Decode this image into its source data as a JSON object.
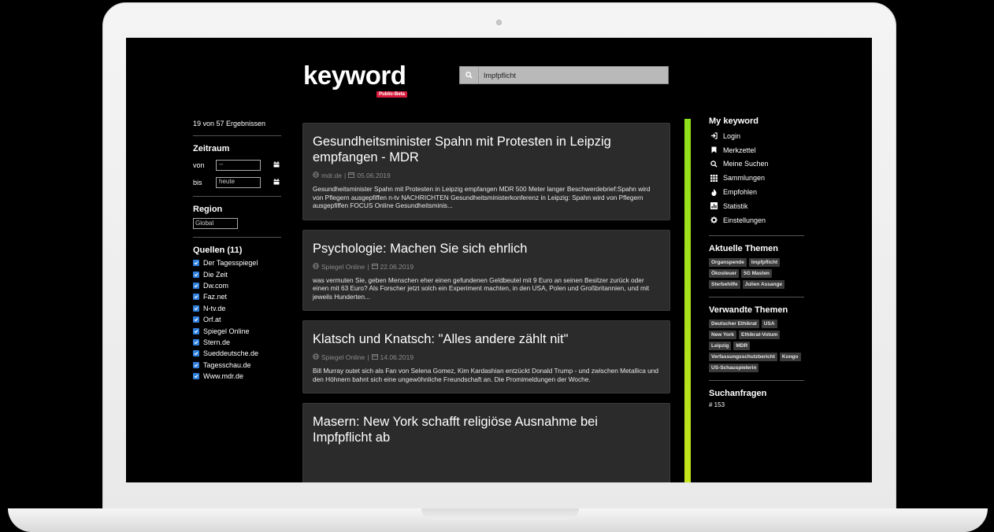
{
  "app": {
    "logo": "keyword",
    "beta_badge": "Public-Beta"
  },
  "search": {
    "value": "Impfpflicht"
  },
  "left": {
    "result_count": "19 von 57 Ergebnissen",
    "zeitraum_heading": "Zeitraum",
    "von_label": "von",
    "von_value": "--",
    "bis_label": "bis",
    "bis_value": "heute",
    "region_heading": "Region",
    "region_value": "Global",
    "sources_heading": "Quellen (11)",
    "sources": [
      "Der Tagesspiegel",
      "Die Zeit",
      "Dw.com",
      "Faz.net",
      "N-tv.de",
      "Orf.at",
      "Spiegel Online",
      "Stern.de",
      "Sueddeutsche.de",
      "Tagesschau.de",
      "Www.mdr.de"
    ]
  },
  "articles": [
    {
      "title": "Gesundheitsminister Spahn mit Protesten in Leipzig empfangen - MDR",
      "source": "mdr.de",
      "date": "05.06.2019",
      "excerpt": "Gesundheitsminister Spahn mit Protesten in Leipzig empfangen MDR 500 Meter langer Beschwerdebrief:Spahn wird von Pflegern ausgepfiffen n-tv NACHRICHTEN Gesundheitsministerkonferenz in Leipzig: Spahn wird von Pflegern ausgepfiffen FOCUS Online Gesundheitsminis..."
    },
    {
      "title": "Psychologie: Machen Sie sich ehrlich",
      "source": "Spiegel Online",
      "date": "22.06.2019",
      "excerpt": "was vermuten Sie, geben Menschen eher einen gefundenen Geldbeutel mit 9 Euro an seinen Besitzer zurück oder einen mit 63 Euro? Als Forscher jetzt solch ein Experiment machten, in den USA, Polen und Großbritannien, und mit jeweils Hunderten..."
    },
    {
      "title": "Klatsch und Knatsch: \"Alles andere zählt nit\"",
      "source": "Spiegel Online",
      "date": "14.06.2019",
      "excerpt": "Bill Murray outet sich als Fan von Selena Gomez, Kim Kardashian entzückt Donald Trump - und zwischen Metallica und den Höhnern bahnt sich eine ungewöhnliche Freundschaft an. Die Promimeldungen der Woche."
    },
    {
      "title": "Masern: New York schafft religiöse Ausnahme bei Impfpflicht ab",
      "source": "",
      "date": "",
      "excerpt": ""
    }
  ],
  "right": {
    "my_heading": "My keyword",
    "menu": [
      {
        "label": "Login",
        "icon": "login-icon"
      },
      {
        "label": "Merkzettel",
        "icon": "bookmark-icon"
      },
      {
        "label": "Meine Suchen",
        "icon": "search-icon"
      },
      {
        "label": "Sammlungen",
        "icon": "grid-icon"
      },
      {
        "label": "Empfohlen",
        "icon": "flame-icon"
      },
      {
        "label": "Statistik",
        "icon": "chart-icon"
      },
      {
        "label": "Einstellungen",
        "icon": "gear-icon"
      }
    ],
    "current_heading": "Aktuelle Themen",
    "current_tags": [
      "Organspende",
      "Impfpflicht",
      "Ökosteuer",
      "5G Masten",
      "Sterbehilfe",
      "Julien Assange"
    ],
    "related_heading": "Verwandte Themen",
    "related_tags": [
      "Deutscher Ethikrat",
      "USA",
      "New York",
      "Ethikrat-Votum",
      "Leipzig",
      "MDR",
      "Verfassungsschutzbericht",
      "Kongo",
      "US-Schauspielerin"
    ],
    "searches_heading": "Suchanfragen",
    "searches_count": "# 153"
  },
  "colors": {
    "accent_bar_top": "#8ee01a",
    "accent_bar_bottom": "#c5e41b",
    "beta_badge": "#d81b3c",
    "checkbox": "#2f7fdc"
  }
}
